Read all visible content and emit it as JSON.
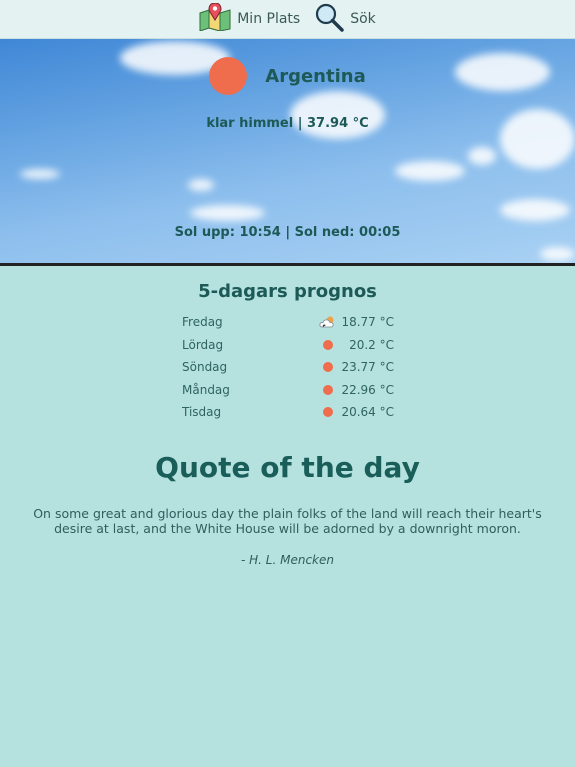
{
  "nav": {
    "my_location_label": "Min Plats",
    "search_label": "Sök"
  },
  "current": {
    "city": "Argentina",
    "description": "klar himmel | 37.94 °C",
    "sun_times": "Sol upp: 10:54 |  Sol ned: 00:05"
  },
  "forecast": {
    "title": "5-dagars prognos",
    "days": [
      {
        "day": "Fredag",
        "icon": "few-clouds-icon",
        "temp": "18.77 °C"
      },
      {
        "day": "Lördag",
        "icon": "sun-icon",
        "temp": "20.2 °C"
      },
      {
        "day": "Söndag",
        "icon": "sun-icon",
        "temp": "23.77 °C"
      },
      {
        "day": "Måndag",
        "icon": "sun-icon",
        "temp": "22.96 °C"
      },
      {
        "day": "Tisdag",
        "icon": "sun-icon",
        "temp": "20.64 °C"
      }
    ]
  },
  "quote": {
    "title": "Quote of the day",
    "text": "On some great and glorious day the plain folks of the land will reach their heart's desire at last, and the White House will be adorned by a downright moron.",
    "author": "- H. L. Mencken"
  },
  "colors": {
    "accent": "#1d5a57",
    "sun": "#ef6d4c",
    "background": "#b5e1df"
  }
}
